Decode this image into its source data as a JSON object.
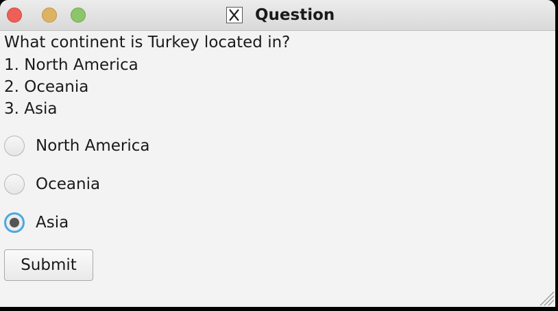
{
  "window": {
    "title": "Question"
  },
  "question": {
    "text": "What continent is Turkey located in?",
    "numbered_options": [
      "1. North America",
      "2. Oceania",
      "3. Asia"
    ]
  },
  "answers": [
    {
      "label": "North America",
      "selected": false
    },
    {
      "label": "Oceania",
      "selected": false
    },
    {
      "label": "Asia",
      "selected": true
    }
  ],
  "submit_label": "Submit",
  "colors": {
    "close": "#ee5f57",
    "minimize": "#dcb363",
    "maximize": "#8cc56b",
    "focus_ring": "#4aa8e0"
  }
}
